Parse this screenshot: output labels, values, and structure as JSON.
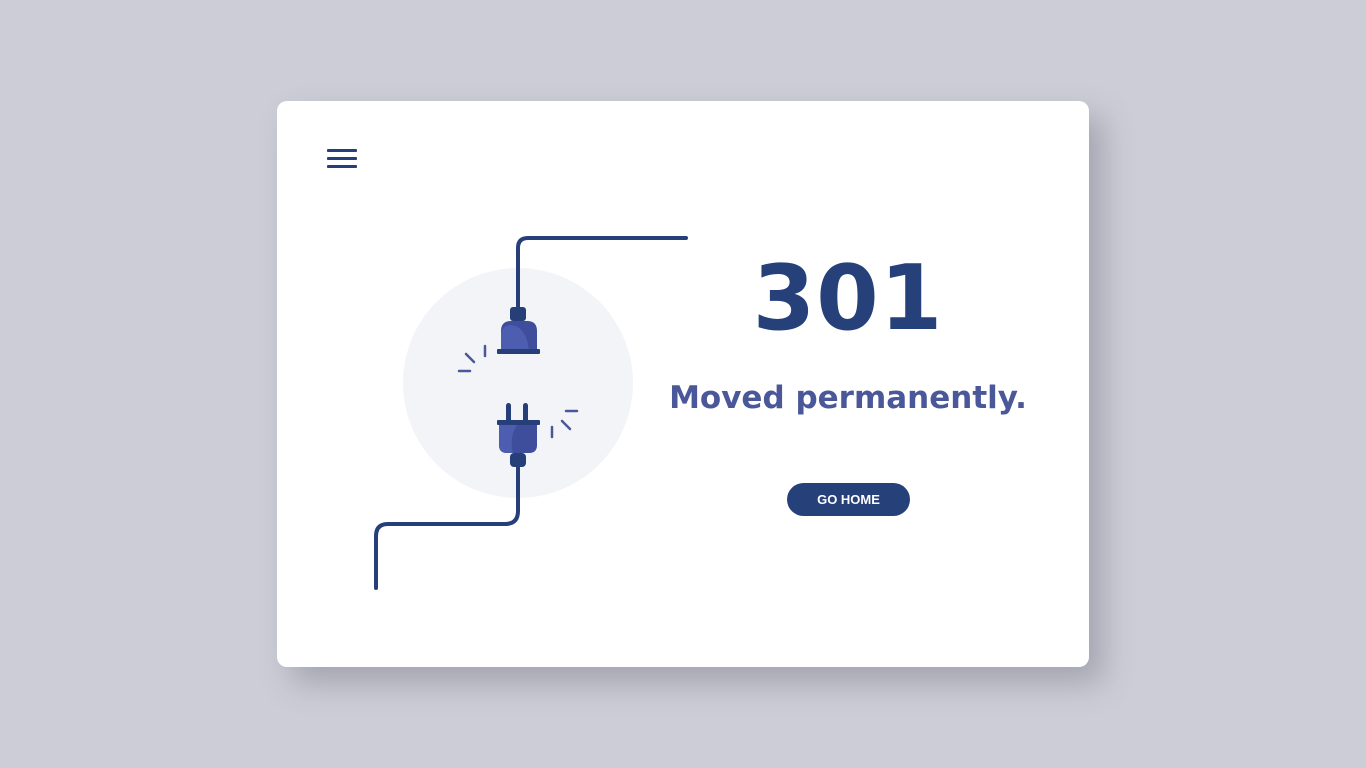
{
  "error": {
    "code": "301",
    "message": "Moved permanently."
  },
  "actions": {
    "go_home_label": "GO HOME"
  },
  "icons": {
    "menu": "hamburger-menu-icon",
    "illustration": "unplugged-cable-icon"
  },
  "colors": {
    "background": "#cccdd6",
    "card": "#ffffff",
    "primary": "#26407a",
    "accent": "#4a5799",
    "plug": "#3e4d9c",
    "circle": "#f3f4f7"
  }
}
